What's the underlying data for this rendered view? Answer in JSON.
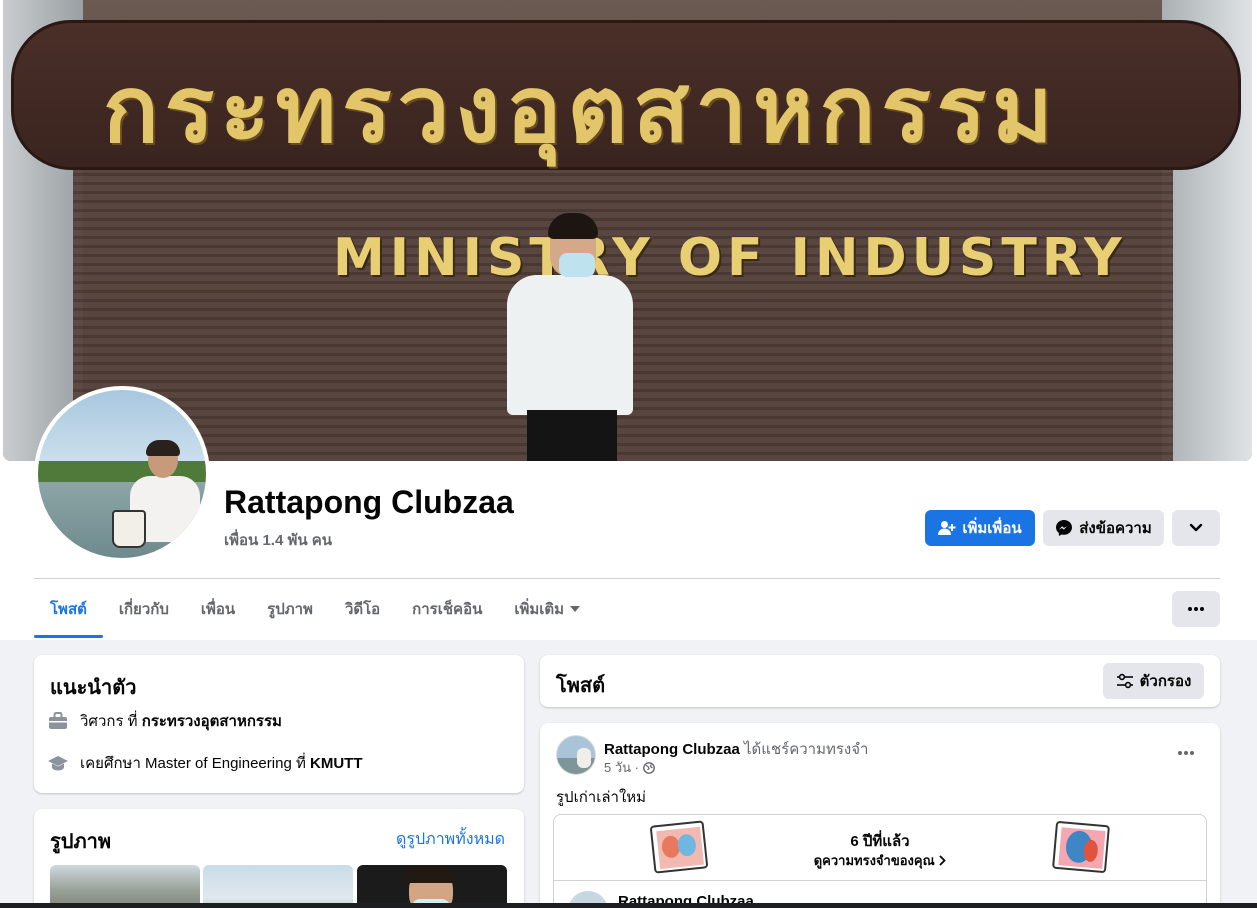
{
  "cover": {
    "sign_thai": "กระทรวงอุตสาหกรรม",
    "sign_english": "MINISTRY OF INDUSTRY"
  },
  "profile": {
    "name": "Rattapong Clubzaa",
    "friends": "เพื่อน 1.4 พัน คน"
  },
  "actions": {
    "add_friend": "เพิ่มเพื่อน",
    "message": "ส่งข้อความ",
    "add_friend_icon": "person-plus-icon",
    "message_icon": "messenger-icon",
    "more_icon": "chevron-down-icon"
  },
  "tabs": [
    {
      "label": "โพสต์",
      "active": true
    },
    {
      "label": "เกี่ยวกับ"
    },
    {
      "label": "เพื่อน"
    },
    {
      "label": "รูปภาพ"
    },
    {
      "label": "วิดีโอ"
    },
    {
      "label": "การเช็คอิน"
    },
    {
      "label": "เพิ่มเติม"
    }
  ],
  "intro": {
    "title": "แนะนำตัว",
    "work": {
      "prefix": "วิศวกร ที่",
      "place": "กระทรวงอุตสาหกรรม",
      "icon": "briefcase-icon"
    },
    "education": {
      "prefix": "เคยศึกษา Master of Engineering ที่",
      "place": "KMUTT",
      "icon": "graduation-cap-icon"
    }
  },
  "photos": {
    "title": "รูปภาพ",
    "see_all": "ดูรูปภาพทั้งหมด"
  },
  "posts": {
    "title": "โพสต์",
    "filter": "ตัวกรอง",
    "filter_icon": "sliders-icon"
  },
  "post": {
    "author": "Rattapong Clubzaa",
    "action": "ได้แชร์ความทรงจำ",
    "time": "5 วัน ·",
    "privacy_icon": "globe-icon",
    "text": "รูปเก่าเล่าใหม่",
    "memory_ago": "6 ปีที่แล้ว",
    "memory_link": "ดูความทรงจำของคุณ",
    "inner_author": "Rattapong Clubzaa"
  },
  "colors": {
    "accent": "#1b74e4",
    "secondary_button": "#e4e6eb",
    "page_bg": "#f0f2f5"
  }
}
